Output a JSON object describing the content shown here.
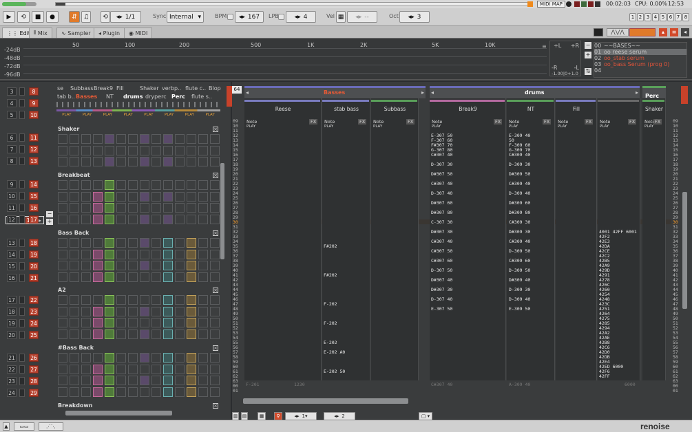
{
  "topbar": {
    "midi_map": "MIDI MAP",
    "time": "00:02:03",
    "cpu": "CPU: 0.00%",
    "clock": "12:53"
  },
  "toolbar": {
    "pattern_pos": "1/1",
    "sync_label": "Sync",
    "sync_value": "Internal",
    "bpm_label": "BPM",
    "bpm_value": "167",
    "lpb_label": "LPB",
    "lpb_value": "4",
    "vel_label": "Vel",
    "vel_value": "-- ",
    "oct_label": "Oct",
    "oct_value": "3",
    "sequence_numbers": [
      "1",
      "2",
      "3",
      "4",
      "5",
      "6",
      "7",
      "8"
    ]
  },
  "tabs": {
    "items": [
      {
        "label": "Edit"
      },
      {
        "label": "Mix"
      },
      {
        "label": "Sampler"
      },
      {
        "label": "Plugin"
      },
      {
        "label": "MIDI"
      }
    ]
  },
  "scope": {
    "db_labels": [
      "-24dB",
      "-48dB",
      "-72dB",
      "-96dB"
    ],
    "freq_labels": [
      "50",
      "100",
      "200",
      "500",
      "1K",
      "2K",
      "5K",
      "10K"
    ],
    "lr_labels": [
      "+L",
      "+R",
      "-R",
      "-L"
    ],
    "lr_value": "-1.00|0+1.0",
    "instrument_rows": [
      {
        "num": "00",
        "name": "~~BASES~~"
      },
      {
        "num": "01",
        "name": "oo reese serum"
      },
      {
        "num": "02",
        "name": "oo_stab serum"
      },
      {
        "num": "03",
        "name": "oo_bass Serum (prog 0)"
      },
      {
        "num": "04",
        "name": ""
      }
    ]
  },
  "mixer": {
    "col_headers": [
      "se",
      "Subbass",
      "Break9",
      "Fill",
      "Shaker",
      "verbp..",
      "flute c..",
      "Blop"
    ],
    "col_headers2": [
      "tab b..",
      "Basses",
      "NT",
      "drums",
      "dryperc",
      "Perc",
      "flute s..",
      ""
    ],
    "play": "PLAY",
    "left_nums": [
      "3",
      "4",
      "5",
      "6",
      "7",
      "8",
      "9",
      "10",
      "11",
      "12",
      "13",
      "14",
      "15",
      "16",
      "17",
      "18",
      "19",
      "20",
      "21",
      "22",
      "23",
      "24"
    ],
    "red_nums": [
      "8",
      "9",
      "10",
      "11",
      "12",
      "13",
      "14",
      "15",
      "16",
      "17",
      "18",
      "19",
      "20",
      "21",
      "22",
      "23",
      "24",
      "25",
      "26",
      "27",
      "28",
      "29"
    ],
    "current": "17",
    "groups": [
      {
        "name": "Shaker"
      },
      {
        "name": "Breakbeat"
      },
      {
        "name": "Bass Back"
      },
      {
        "name": "A2"
      },
      {
        "name": "#Bass Back"
      },
      {
        "name": "Breakdown"
      }
    ]
  },
  "pattern": {
    "pattern_num": "64",
    "group_basses": "Basses",
    "group_drums": "drums",
    "group_perc": "Perc",
    "tracks": [
      {
        "name": "Reese"
      },
      {
        "name": "stab bass"
      },
      {
        "name": "Subbass"
      },
      {
        "name": "Break9"
      },
      {
        "name": "NT"
      },
      {
        "name": "Fill"
      },
      {
        "name": "Shaker"
      }
    ],
    "col_labels": {
      "note": "Note",
      "fx": "FX",
      "play": "PLAY"
    },
    "row_numbers": [
      "09",
      "10",
      "11",
      "12",
      "13",
      "14",
      "15",
      "16",
      "17",
      "18",
      "19",
      "20",
      "21",
      "22",
      "23",
      "24",
      "25",
      "26",
      "27",
      "28",
      "29",
      "30",
      "31",
      "32",
      "33",
      "34",
      "35",
      "36",
      "37",
      "38",
      "39",
      "40",
      "41",
      "42",
      "43",
      "44",
      "45",
      "46",
      "47",
      "48",
      "49",
      "50",
      "51",
      "52",
      "53",
      "54",
      "55",
      "56",
      "57",
      "58",
      "59",
      "60",
      "61",
      "62",
      "63",
      "00",
      "01"
    ],
    "current_row": "30",
    "break9_notes": [
      "E-307 50",
      "F-307 60",
      "F#307 70",
      "G-307 80",
      "C#307 40",
      "D-307 30",
      "D#307 50",
      "C#307 40",
      "D-307 40",
      "D#307 60",
      "D#307 80",
      "C-307 30",
      "D#307 30",
      "C#307 40",
      "C#307 50",
      "C#307 60",
      "D-307 50",
      "D#307 40",
      "D#307 30",
      "D-307 40",
      "E-307 50"
    ],
    "nt_notes": [
      "E-309 40",
      "50",
      "F-309 60",
      "G-309 70",
      "C#309 40",
      "D-309 30",
      "D#309 50",
      "C#309 40",
      "D-309 40",
      "D#309 60",
      "D#309 80",
      "C#309 30",
      "D#309 30",
      "C#309 40",
      "D-309 50",
      "C#309 60",
      "D-309 50",
      "D#309 40",
      "D-309 30",
      "D-309 40",
      "E-309 50"
    ],
    "stab_notes": [
      "F#202",
      "F#202",
      "F-202",
      "F-202",
      "E-202",
      "E-202 A0",
      "E-202 50"
    ],
    "fx_values": [
      "4001 42FF 6001",
      "42F2",
      "42E3",
      "42DA",
      "42CE",
      "42C2",
      "42B5",
      "42A9",
      "429D",
      "4291",
      "4278",
      "426C",
      "4260",
      "4254",
      "4248",
      "423C",
      "4251",
      "4264",
      "4275",
      "4285",
      "4294",
      "42A2",
      "42AE",
      "42B8",
      "42C6",
      "42D0",
      "42DB",
      "42E4",
      "42ED 6000",
      "42F6",
      "42FF"
    ],
    "footer_left": "F-201",
    "footer_1230": "1230",
    "footer_c": "C#307 40",
    "footer_a": "A-309 40",
    "footer_6000": "6000"
  },
  "bottombar": {
    "page1": "1",
    "page2": "2",
    "logo": "renoise"
  }
}
